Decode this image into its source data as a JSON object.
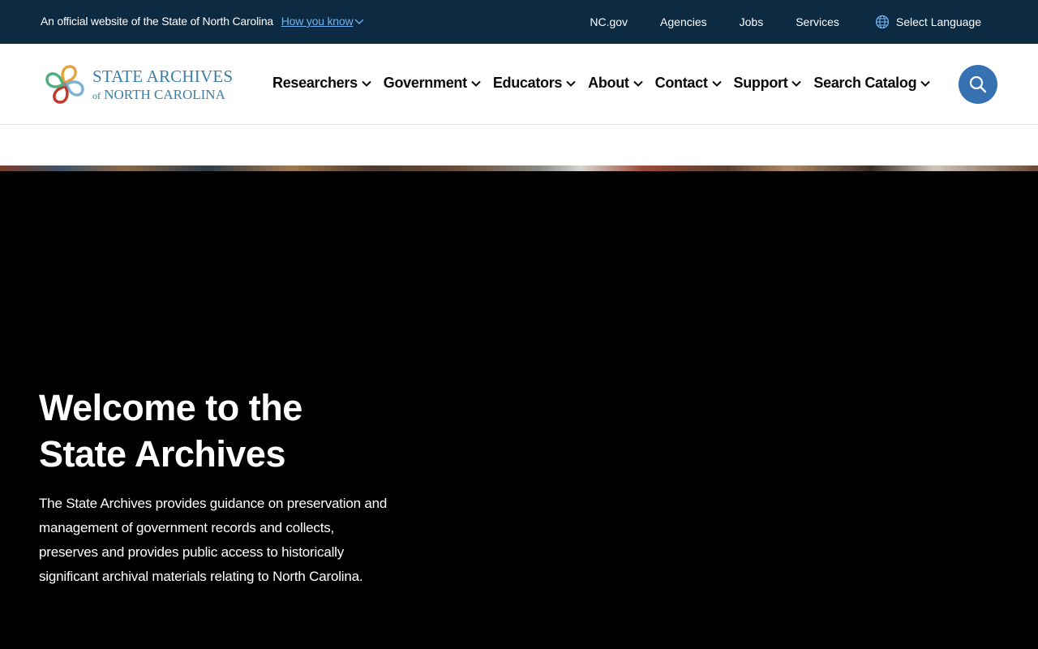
{
  "gov_banner": {
    "official_text": "An official website of the State of North Carolina",
    "how_you_know": "How you know",
    "links": [
      "NC.gov",
      "Agencies",
      "Jobs",
      "Services"
    ],
    "language": "Select Language"
  },
  "header": {
    "logo_line1": "STATE ARCHIVES",
    "logo_of": "of",
    "logo_line2": "NORTH CAROLINA",
    "nav": [
      "Researchers",
      "Government",
      "Educators",
      "About",
      "Contact",
      "Support",
      "Search Catalog"
    ],
    "search_icon": "search-icon"
  },
  "hero": {
    "title": "Welcome to the State Archives",
    "description": "The State Archives provides guidance on preservation and management of government records and collects, preserves and provides public access to historically significant archival materials relating to North Carolina."
  },
  "colors": {
    "gov_bar": "#0c2a42",
    "link_blue": "#6fb3ef",
    "search_button": "#3671b1",
    "logo_text": "#3d7ea6"
  }
}
